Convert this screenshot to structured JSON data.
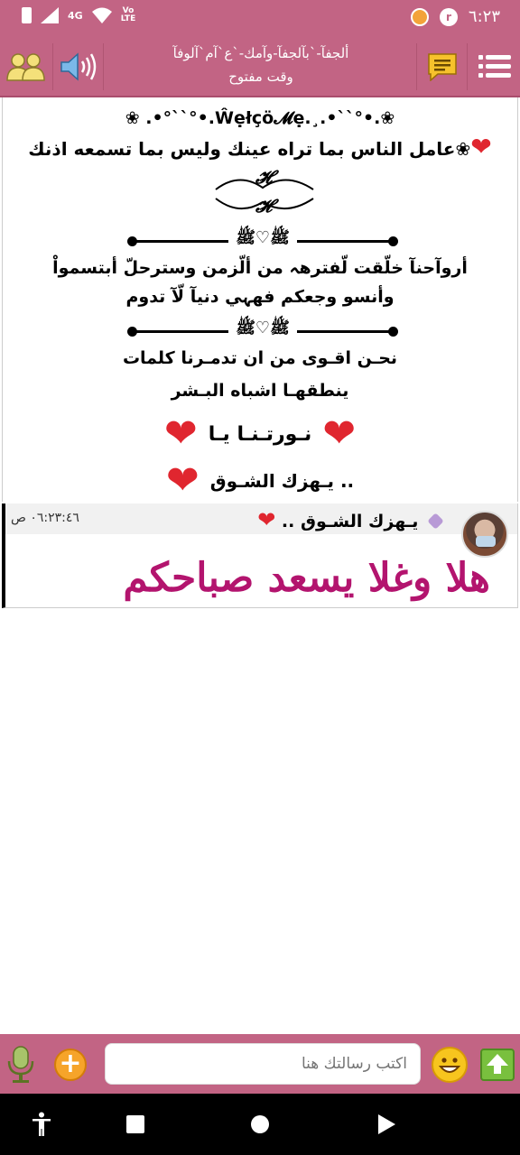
{
  "status_bar": {
    "network": "4G",
    "volte_top": "Vo",
    "volte_bottom": "LTE",
    "time": "٦:٢٣",
    "dot2_label": "r"
  },
  "header": {
    "title_line1": "ألجفآ-`بآلجفآ-وآمك-`ع`آم`آلوفآ",
    "title_line2": "وقت مفتوح"
  },
  "welcome": {
    "line1": "❀ .•°``°•.Ŵẹłçö𝓜ẹ.¸.•``°•.❀",
    "line2": "عامل الناس بما تراه عينك وليس بما تسمعه اذنك❀",
    "monogram_top": "𝓗",
    "monogram_bottom": "𝓗",
    "divider_mid": "ﷺ♡ﷺ",
    "line3": "أروآحنآ خلّقت لّفترهہ من ألّزمن وسترحلّ أبتسمواْ",
    "line4": "وأنسو وجعكم فهہي دنيآ لّآ تدوم",
    "line5": "نحـن اقـوى من ان تدمـرنا كلمات",
    "line6": "ينطقهـا اشباه البـشر",
    "line7": "نـورتـنـا يـا",
    "line8": "يـهزك الشـوق .."
  },
  "message": {
    "time": "٠٦:٢٣:٤٦ ص",
    "sender": "يـهزك الشـوق ..",
    "sender_heart": "❤",
    "text": "هلا وغلا يسعد صباحكم"
  },
  "input": {
    "placeholder": "اكتب رسالتك هنا",
    "plus_label": "+"
  },
  "colors": {
    "primary": "#c26484",
    "message_text": "#b3146e",
    "heart": "#e0262f"
  }
}
